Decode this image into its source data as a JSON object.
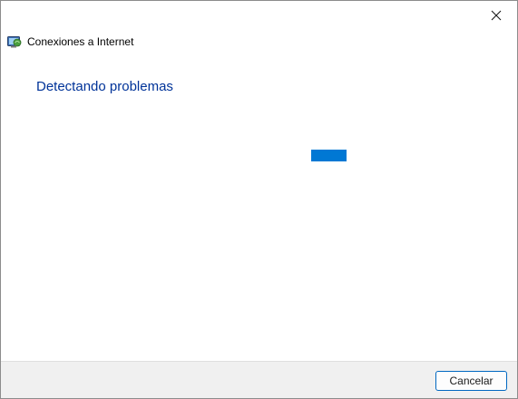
{
  "window": {
    "title": "Conexiones a Internet",
    "icon": "network-troubleshooter-icon",
    "close_icon": "close-icon"
  },
  "main": {
    "heading": "Detectando problemas",
    "progress": {
      "style": "indeterminate",
      "color": "#0078d4"
    }
  },
  "footer": {
    "cancel_label": "Cancelar"
  },
  "colors": {
    "heading": "#003399",
    "accent": "#0078d4",
    "footer_bg": "#f0f0f0"
  }
}
